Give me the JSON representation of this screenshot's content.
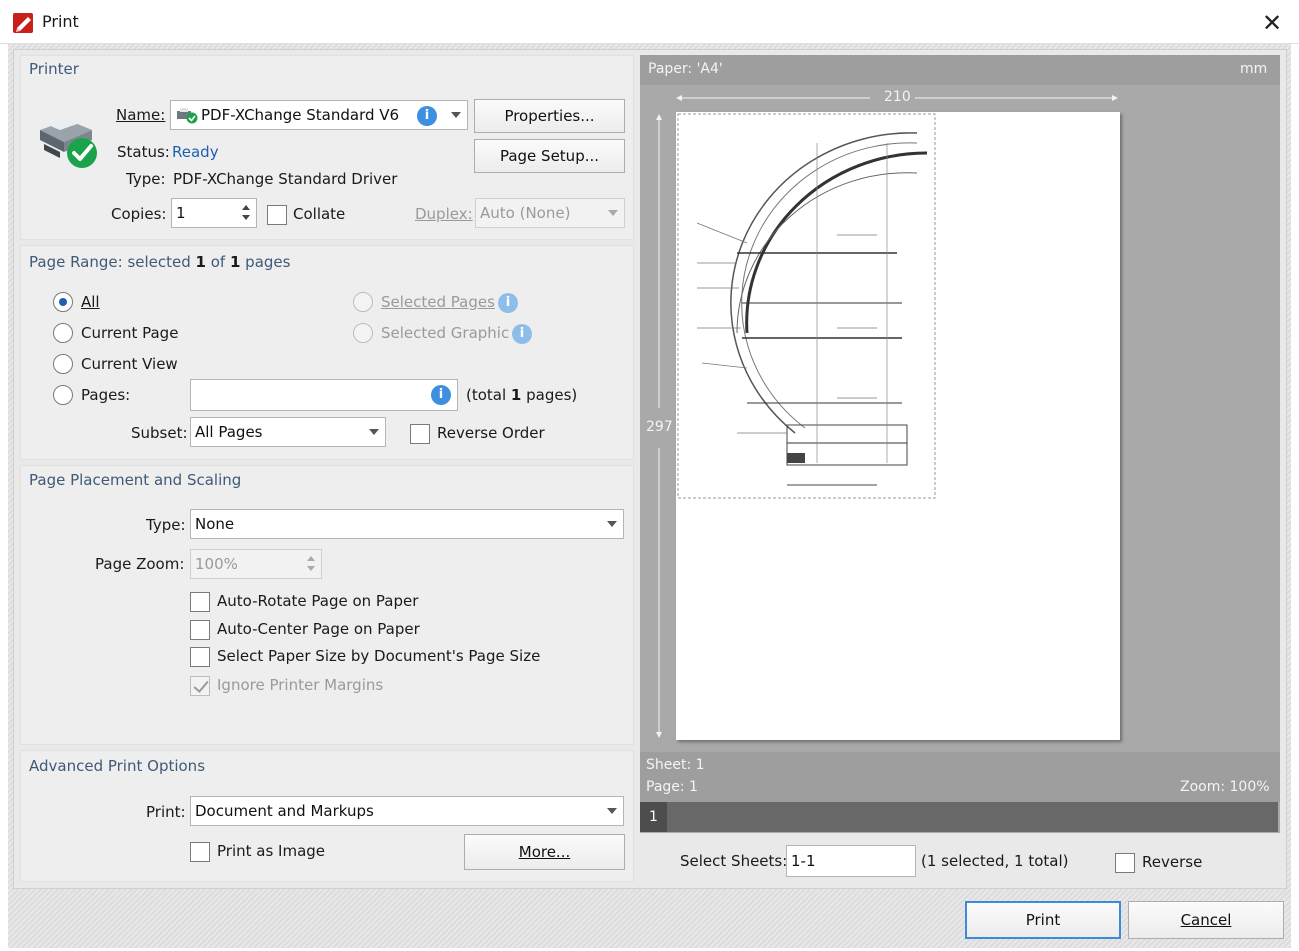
{
  "window": {
    "title": "Print",
    "close_glyph": "✕"
  },
  "printer": {
    "section_title": "Printer",
    "name_label": "Name:",
    "name_value": "PDF-XChange Standard V6",
    "properties_button": "Properties...",
    "page_setup_button": "Page Setup...",
    "status_label": "Status:",
    "status_value": "Ready",
    "type_label": "Type:",
    "type_value": "PDF-XChange Standard Driver",
    "copies_label": "Copies:",
    "copies_value": "1",
    "collate_label": "Collate",
    "duplex_label": "Duplex:",
    "duplex_value": "Auto (None)"
  },
  "page_range": {
    "title_prefix": "Page Range: selected ",
    "selected": "1",
    "title_middle": " of ",
    "total": "1",
    "title_suffix": " pages",
    "options": {
      "all": "All",
      "current_page": "Current Page",
      "current_view": "Current View",
      "pages": "Pages:",
      "selected_pages": "Selected Pages",
      "selected_graphic": "Selected Graphic"
    },
    "pages_value": "",
    "total_prefix": "(total ",
    "total_count": "1",
    "total_suffix": " pages)",
    "subset_label": "Subset:",
    "subset_value": "All Pages",
    "reverse_label": "Reverse Order"
  },
  "placement": {
    "section_title": "Page Placement and Scaling",
    "type_label": "Type:",
    "type_value": "None",
    "zoom_label": "Page Zoom:",
    "zoom_value": "100%",
    "auto_rotate": "Auto-Rotate Page on Paper",
    "auto_center": "Auto-Center Page on Paper",
    "select_paper": "Select Paper Size by Document's Page Size",
    "ignore_margins": "Ignore Printer Margins"
  },
  "advanced": {
    "section_title": "Advanced Print Options",
    "print_label": "Print:",
    "print_value": "Document and Markups",
    "print_as_image": "Print as Image",
    "more_button": "More..."
  },
  "preview": {
    "paper_label": "Paper: 'A4'",
    "units": "mm",
    "width_dim": "210",
    "height_dim": "297",
    "sheet_label": "Sheet: 1",
    "page_label": "Page: 1",
    "zoom_label": "Zoom: 100%",
    "thumb_number": "1"
  },
  "sheets": {
    "label": "Select Sheets:",
    "value": "1-1",
    "summary": "(1 selected, 1 total)",
    "reverse_label": "Reverse"
  },
  "footer": {
    "print_button": "Print",
    "cancel_button": "Cancel"
  }
}
